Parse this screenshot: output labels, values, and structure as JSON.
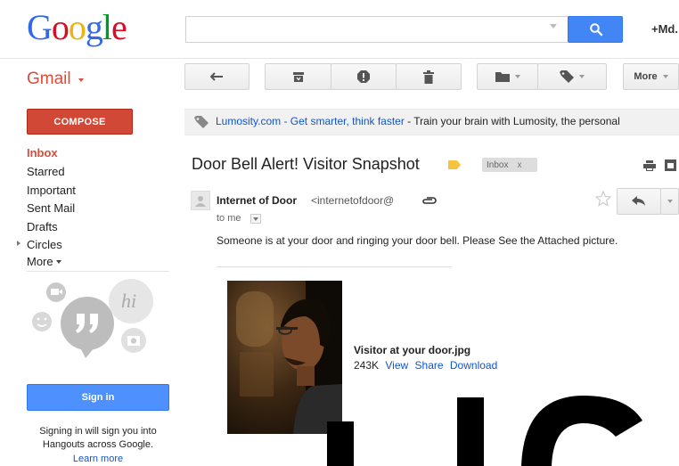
{
  "header": {
    "logo_letters": [
      {
        "ch": "G",
        "color": "#3369e8"
      },
      {
        "ch": "o",
        "color": "#d50f25"
      },
      {
        "ch": "o",
        "color": "#eeb211"
      },
      {
        "ch": "g",
        "color": "#3369e8"
      },
      {
        "ch": "l",
        "color": "#009925"
      },
      {
        "ch": "e",
        "color": "#d50f25"
      }
    ],
    "search_value": "",
    "user_name": "+Md."
  },
  "app": {
    "label": "Gmail"
  },
  "toolbar": {
    "buttons": [
      "back-icon",
      "archive-icon",
      "report-spam-icon",
      "delete-icon",
      "move-to-icon",
      "labels-icon"
    ],
    "more_label": "More"
  },
  "nav": {
    "compose_label": "COMPOSE",
    "items": [
      "Inbox",
      "Starred",
      "Important",
      "Sent Mail",
      "Drafts",
      "Circles",
      "More"
    ]
  },
  "hangouts": {
    "sign_in_label": "Sign in",
    "line1": "Signing in will sign you into",
    "line2": "Hangouts across Google.",
    "learn_more": "Learn more"
  },
  "ad": {
    "link_text": "Lumosity.com - Get smarter, think faster",
    "rest_text": " - Train your brain with Lumosity, the personal"
  },
  "message": {
    "subject": "Door Bell Alert! Visitor Snapshot",
    "label_chip": "Inbox",
    "label_chip_close": "x",
    "sender_name": "Internet of Door",
    "sender_email": "<internetofdoor@",
    "recipient": "to me",
    "body": "Someone is at your door and ringing your door bell. Please See the Attached picture.",
    "attachment": {
      "filename": "Visitor at your door.jpg",
      "size": "243K",
      "actions": [
        "View",
        "Share",
        "Download"
      ]
    }
  },
  "colors": {
    "gmail_red": "#dd4b39",
    "compose_red": "#d14836",
    "search_blue": "#4285f4",
    "link_blue": "#1155cc",
    "label_yellow": "#f4c340"
  }
}
